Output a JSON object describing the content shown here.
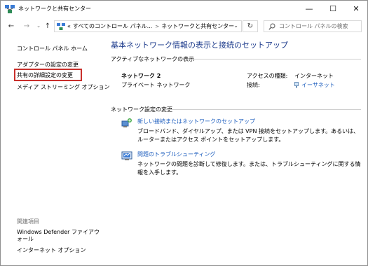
{
  "window": {
    "title": "ネットワークと共有センター",
    "minimize": "—",
    "maximize": "☐",
    "close": "✕"
  },
  "address_bar": {
    "overflow": "«",
    "crumbs": [
      "すべてのコントロール パネル...",
      "ネットワークと共有センター"
    ],
    "separator": ">",
    "search_placeholder": "コントロール パネルの検索"
  },
  "left_pane": {
    "home": "コントロール パネル ホーム",
    "items": [
      "アダプターの設定の変更",
      "共有の詳細設定の変更",
      "メディア ストリーミング オプション"
    ],
    "related_heading": "関連項目",
    "related": [
      "Windows Defender ファイアウォール",
      "インターネット オプション"
    ]
  },
  "main": {
    "title": "基本ネットワーク情報の表示と接続のセットアップ",
    "active_heading": "アクティブなネットワークの表示",
    "network_name": "ネットワーク 2",
    "network_type": "プライベート ネットワーク",
    "access_label": "アクセスの種類:",
    "access_value": "インターネット",
    "connection_label": "接続:",
    "connection_value": "イーサネット",
    "settings_heading": "ネットワーク設定の変更",
    "tasks": [
      {
        "link": "新しい接続またはネットワークのセットアップ",
        "desc": "ブロードバンド、ダイヤルアップ、または VPN 接続をセットアップします。あるいは、ルーターまたはアクセス ポイントをセットアップします。"
      },
      {
        "link": "問題のトラブルシューティング",
        "desc": "ネットワークの問題を診断して修復します。または、トラブルシューティングに関する情報を入手します。"
      }
    ]
  },
  "colors": {
    "title_blue": "#1e3c8c",
    "link_blue": "#1f5fbf",
    "highlight_red": "#c9302c"
  }
}
